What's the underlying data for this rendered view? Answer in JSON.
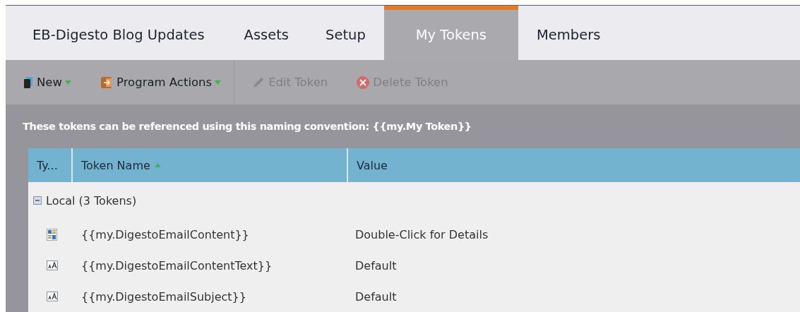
{
  "tabs": [
    {
      "label": "EB-Digesto Blog Updates",
      "selected": false
    },
    {
      "label": "Assets",
      "selected": false
    },
    {
      "label": "Setup",
      "selected": false
    },
    {
      "label": "My Tokens",
      "selected": true
    },
    {
      "label": "Members",
      "selected": false
    }
  ],
  "toolbar": [
    {
      "label": "New",
      "kind": "new",
      "dropdown": true,
      "disabled": false
    },
    {
      "label": "Program Actions",
      "kind": "actions",
      "dropdown": true,
      "disabled": false
    },
    {
      "label": "Edit Token",
      "kind": "edit",
      "dropdown": false,
      "disabled": true
    },
    {
      "label": "Delete Token",
      "kind": "delete",
      "dropdown": false,
      "disabled": true
    }
  ],
  "info": "These tokens can be referenced using this naming convention: {{my.My Token}}",
  "table": {
    "columns": [
      {
        "label": "Ty...",
        "sorted": false
      },
      {
        "label": "Token Name",
        "sorted": true
      },
      {
        "label": "Value",
        "sorted": false
      }
    ],
    "groups": [
      {
        "label": "Local (3 Tokens)",
        "expanded": true,
        "rows": [
          {
            "kind": "rich",
            "name": "{{my.DigestoEmailContent}}",
            "value": "Double-Click for Details"
          },
          {
            "kind": "text",
            "name": "{{my.DigestoEmailContentText}}",
            "value": "Default"
          },
          {
            "kind": "text",
            "name": "{{my.DigestoEmailSubject}}",
            "value": "Default"
          }
        ]
      }
    ]
  }
}
